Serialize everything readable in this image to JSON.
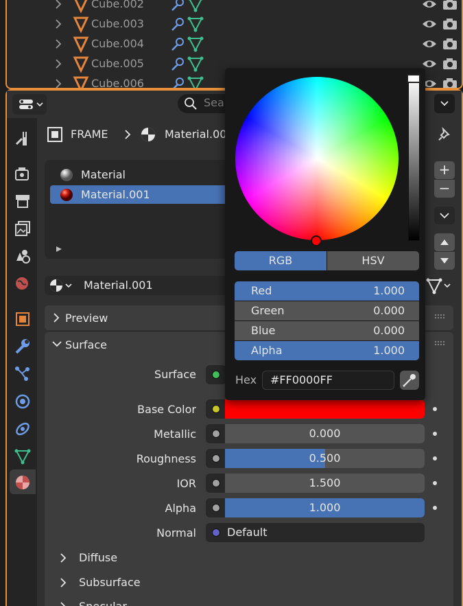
{
  "outliner": {
    "rows": [
      {
        "name": "Cube.002"
      },
      {
        "name": "Cube.003"
      },
      {
        "name": "Cube.004"
      },
      {
        "name": "Cube.005"
      },
      {
        "name": "Cube.006"
      }
    ]
  },
  "header": {
    "search_placeholder": "Sea"
  },
  "context": {
    "object": "FRAME",
    "material": "Material.00"
  },
  "slots": {
    "items": [
      {
        "name": "Material"
      },
      {
        "name": "Material.001"
      }
    ]
  },
  "material_selector": {
    "name": "Material.001"
  },
  "panels": {
    "preview": "Preview",
    "surface": "Surface"
  },
  "surface_props": {
    "surface_label": "Surface",
    "base_color_label": "Base Color",
    "metallic_label": "Metallic",
    "metallic_value": "0.000",
    "metallic_fraction": 0.0,
    "roughness_label": "Roughness",
    "roughness_value": "0.500",
    "roughness_fraction": 0.5,
    "ior_label": "IOR",
    "ior_value": "1.500",
    "alpha_label": "Alpha",
    "alpha_value": "1.000",
    "alpha_fraction": 1.0,
    "normal_label": "Normal",
    "normal_value": "Default"
  },
  "subpanels": [
    "Diffuse",
    "Subsurface",
    "Specular"
  ],
  "picker": {
    "modes": [
      "RGB",
      "HSV"
    ],
    "active_mode": "RGB",
    "channels": [
      {
        "label": "Red",
        "value": "1.000",
        "active": true
      },
      {
        "label": "Green",
        "value": "0.000",
        "active": false
      },
      {
        "label": "Blue",
        "value": "0.000",
        "active": false
      },
      {
        "label": "Alpha",
        "value": "1.000",
        "active": true
      }
    ],
    "hex_label": "Hex",
    "hex_value": "#FF0000FF",
    "color": "#ff0000"
  },
  "colors": {
    "accent": "#4772b3",
    "outline_active": "#e8913a",
    "object_icon": "#e3853d",
    "mesh_icon": "#3fbf8f",
    "modifier_icon": "#6d9de8"
  }
}
